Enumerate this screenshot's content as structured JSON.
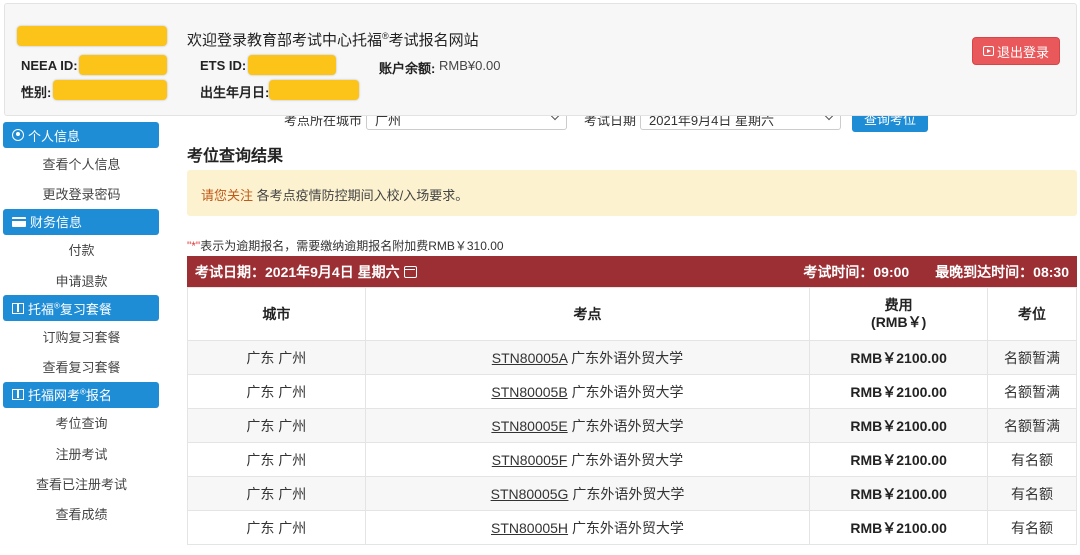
{
  "header": {
    "welcome_text": "欢迎登录教育部考试中心托福",
    "welcome_sup": "®",
    "welcome_suffix": "考试报名网站",
    "neea_id_label": "NEEA ID:",
    "ets_id_label": "ETS ID:",
    "balance_label": "账户余额:",
    "balance_value": "RMB¥0.00",
    "gender_label": "性别:",
    "birthdate_label": "出生年月日:",
    "logout_label": "退出登录"
  },
  "sidebar": {
    "sections": [
      {
        "title": "个人信息",
        "icon": "user-circle-icon",
        "items": [
          "查看个人信息",
          "更改登录密码"
        ]
      },
      {
        "title": "财务信息",
        "icon": "credit-card-icon",
        "items": [
          "付款",
          "申请退款"
        ]
      },
      {
        "title": "托福",
        "title_sup": "®",
        "title_suffix": "复习套餐",
        "icon": "book-icon",
        "items": [
          "订购复习套餐",
          "查看复习套餐"
        ]
      },
      {
        "title": "托福网考",
        "title_sup": "®",
        "title_suffix": "报名",
        "icon": "book-icon",
        "items": [
          "考位查询",
          "注册考试",
          "查看已注册考试",
          "查看成绩"
        ]
      }
    ]
  },
  "search": {
    "city_label": "考点所在城市",
    "city_value": "广州",
    "date_label": "考试日期",
    "date_value": "2021年9月4日 星期六",
    "query_button": "查询考位"
  },
  "results": {
    "title": "考位查询结果",
    "notice_lead": "请您关注",
    "notice_text": " 各考点疫情防控期间入校/入场要求。",
    "late_note_mark": "\"*\"",
    "late_note_text": "表示为逾期报名，需要缴纳逾期报名附加费RMB￥310.00",
    "bar_date": "考试日期：2021年9月4日 星期六",
    "bar_exam_time": "考试时间：09:00",
    "bar_arrival_time": "最晚到达时间：08:30",
    "columns": {
      "city": "城市",
      "venue": "考点",
      "fee_line1": "费用",
      "fee_line2": "(RMB￥)",
      "seats": "考位"
    },
    "rows": [
      {
        "city": "广东 广州",
        "code": "STN80005A",
        "venue": "广东外语外贸大学",
        "fee": "RMB￥2100.00",
        "seats": "名额暂满"
      },
      {
        "city": "广东 广州",
        "code": "STN80005B",
        "venue": "广东外语外贸大学",
        "fee": "RMB￥2100.00",
        "seats": "名额暂满"
      },
      {
        "city": "广东 广州",
        "code": "STN80005E",
        "venue": "广东外语外贸大学",
        "fee": "RMB￥2100.00",
        "seats": "名额暂满"
      },
      {
        "city": "广东 广州",
        "code": "STN80005F",
        "venue": "广东外语外贸大学",
        "fee": "RMB￥2100.00",
        "seats": "有名额"
      },
      {
        "city": "广东 广州",
        "code": "STN80005G",
        "venue": "广东外语外贸大学",
        "fee": "RMB￥2100.00",
        "seats": "有名额"
      },
      {
        "city": "广东 广州",
        "code": "STN80005H",
        "venue": "广东外语外贸大学",
        "fee": "RMB￥2100.00",
        "seats": "有名额"
      }
    ]
  },
  "colors": {
    "accent_blue": "#1f8dd6",
    "bar_red": "#9b2f34",
    "logout_red": "#e9585b",
    "redaction_yellow": "#fcc419",
    "notice_bg": "#fcf2cf"
  }
}
